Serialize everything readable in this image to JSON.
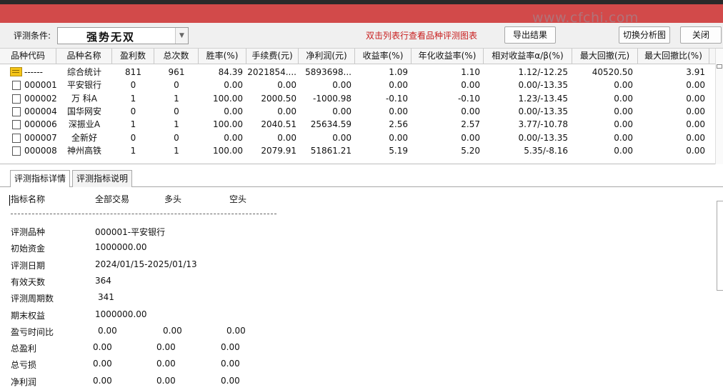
{
  "watermark": "www.cfchi.com",
  "toolbar": {
    "condition_label": "评测条件:",
    "condition_value": "强势无双",
    "hint": "双击列表行查看品种评测图表",
    "export_label": "导出结果",
    "switch_label": "切换分析图",
    "close_label": "关闭"
  },
  "grid": {
    "columns": [
      "品种代码",
      "品种名称",
      "盈利数",
      "总次数",
      "胜率(%)",
      "手续费(元)",
      "净利润(元)",
      "收益率(%)",
      "年化收益率(%)",
      "相对收益率α/β(%)",
      "最大回撤(元)",
      "最大回撤比(%)"
    ],
    "rows": [
      {
        "icon": "folder-icon",
        "cells": [
          "------",
          "综合统计",
          "811",
          "961",
          "84.39",
          "2021854....",
          "5893698...",
          "1.09",
          "1.10",
          "1.12/-12.25",
          "40520.50",
          "3.91"
        ]
      },
      {
        "icon": "document-icon",
        "cells": [
          "000001",
          "平安银行",
          "0",
          "0",
          "0.00",
          "0.00",
          "0.00",
          "0.00",
          "0.00",
          "0.00/-13.35",
          "0.00",
          "0.00"
        ]
      },
      {
        "icon": "document-icon",
        "cells": [
          "000002",
          "万 科A",
          "1",
          "1",
          "100.00",
          "2000.50",
          "-1000.98",
          "-0.10",
          "-0.10",
          "1.23/-13.45",
          "0.00",
          "0.00"
        ]
      },
      {
        "icon": "document-icon",
        "cells": [
          "000004",
          "国华网安",
          "0",
          "0",
          "0.00",
          "0.00",
          "0.00",
          "0.00",
          "0.00",
          "0.00/-13.35",
          "0.00",
          "0.00"
        ]
      },
      {
        "icon": "document-icon",
        "cells": [
          "000006",
          "深振业A",
          "1",
          "1",
          "100.00",
          "2040.51",
          "25634.59",
          "2.56",
          "2.57",
          "3.77/-10.78",
          "0.00",
          "0.00"
        ]
      },
      {
        "icon": "document-icon",
        "cells": [
          "000007",
          "全新好",
          "0",
          "0",
          "0.00",
          "0.00",
          "0.00",
          "0.00",
          "0.00",
          "0.00/-13.35",
          "0.00",
          "0.00"
        ]
      },
      {
        "icon": "document-icon",
        "cells": [
          "000008",
          "神州高铁",
          "1",
          "1",
          "100.00",
          "2079.91",
          "51861.21",
          "5.19",
          "5.20",
          "5.35/-8.16",
          "0.00",
          "0.00"
        ]
      }
    ]
  },
  "tabs": [
    "评测指标详情",
    "评测指标说明"
  ],
  "detail": {
    "headers": [
      "指标名称",
      "全部交易",
      "多头",
      "空头"
    ],
    "info": [
      {
        "label": "评测品种",
        "value": "000001-平安银行"
      },
      {
        "label": "初始资金",
        "value": "1000000.00"
      },
      {
        "label": "评测日期",
        "value": "2024/01/15-2025/01/13"
      },
      {
        "label": "有效天数",
        "value": "364"
      },
      {
        "label": "评测周期数",
        "value": "341"
      },
      {
        "label": "期末权益",
        "value": "1000000.00"
      }
    ],
    "stats": [
      {
        "label": "盈亏时间比",
        "all": "0.00",
        "long": "0.00",
        "short": "0.00"
      },
      {
        "label": "总盈利",
        "all": "0.00",
        "long": "0.00",
        "short": "0.00"
      },
      {
        "label": "总亏损",
        "all": "0.00",
        "long": "0.00",
        "short": "0.00"
      },
      {
        "label": "净利润",
        "all": "0.00",
        "long": "0.00",
        "short": "0.00"
      }
    ]
  }
}
